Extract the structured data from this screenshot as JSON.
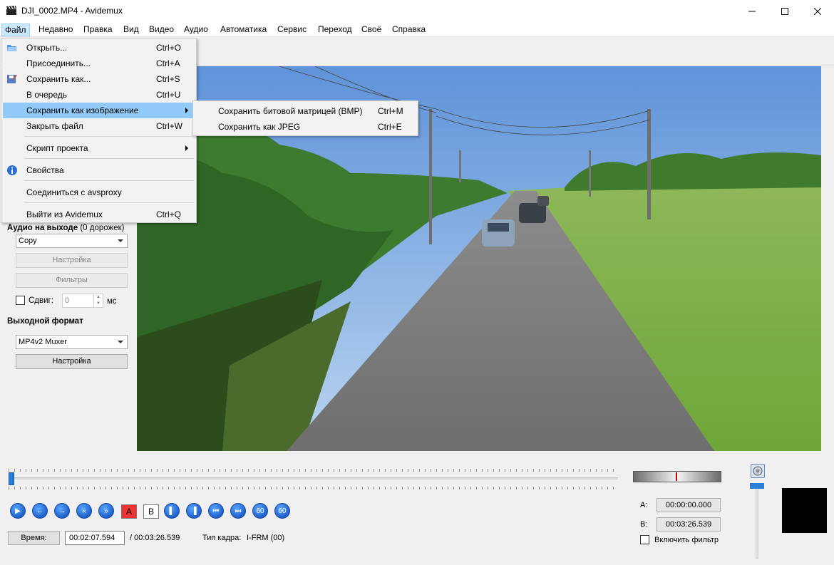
{
  "window": {
    "title": "DJI_0002.MP4 - Avidemux"
  },
  "menubar": {
    "items": [
      "Файл",
      "Недавно",
      "Правка",
      "Вид",
      "Видео",
      "Аудио",
      "Автоматика",
      "Сервис",
      "Переход",
      "Своё",
      "Справка"
    ]
  },
  "file_menu": {
    "open": {
      "label": "Открыть...",
      "shortcut": "Ctrl+O"
    },
    "append": {
      "label": "Присоединить...",
      "shortcut": "Ctrl+A"
    },
    "save_as": {
      "label": "Сохранить как...",
      "shortcut": "Ctrl+S"
    },
    "queue": {
      "label": "В очередь",
      "shortcut": "Ctrl+U"
    },
    "save_image": {
      "label": "Сохранить как изображение"
    },
    "close": {
      "label": "Закрыть файл",
      "shortcut": "Ctrl+W"
    },
    "project_script": {
      "label": "Скрипт проекта"
    },
    "properties": {
      "label": "Свойства"
    },
    "avsproxy": {
      "label": "Соединиться с avsproxy"
    },
    "exit": {
      "label": "Выйти из Avidemux",
      "shortcut": "Ctrl+Q"
    }
  },
  "submenu": {
    "bmp": {
      "label": "Сохранить битовой матрицей (BMP)",
      "shortcut": "Ctrl+M"
    },
    "jpeg": {
      "label": "Сохранить как JPEG",
      "shortcut": "Ctrl+E"
    }
  },
  "left_panel": {
    "audio_output_label": "Аудио на выходе",
    "audio_output_tracks": "(0 дорожек)",
    "audio_codec": "Copy",
    "audio_config_button": "Настройка",
    "audio_filters_button": "Фильтры",
    "shift_label": "Сдвиг:",
    "shift_value": "0",
    "shift_unit": "мс",
    "output_format_label": "Выходной формат",
    "output_format": "MP4v2 Muxer",
    "output_config_button": "Настройка"
  },
  "bottom": {
    "time_button": "Время:",
    "current_time": "00:02:07.594",
    "total_time": "/ 00:03:26.539",
    "frame_type_label": "Тип кадра:",
    "frame_type_value": "I-FRM (00)",
    "marker_a_label": "A:",
    "marker_a_value": "00:00:00.000",
    "marker_b_label": "B:",
    "marker_b_value": "00:03:26.539",
    "filter_checkbox": "Включить фильтр",
    "btn_a": "A",
    "btn_b": "B",
    "btn_60": "60"
  },
  "playback": {
    "position_fraction": 0.0
  },
  "colors": {
    "menu_highlight": "#91c9f7",
    "accent": "#2a7fd4"
  }
}
